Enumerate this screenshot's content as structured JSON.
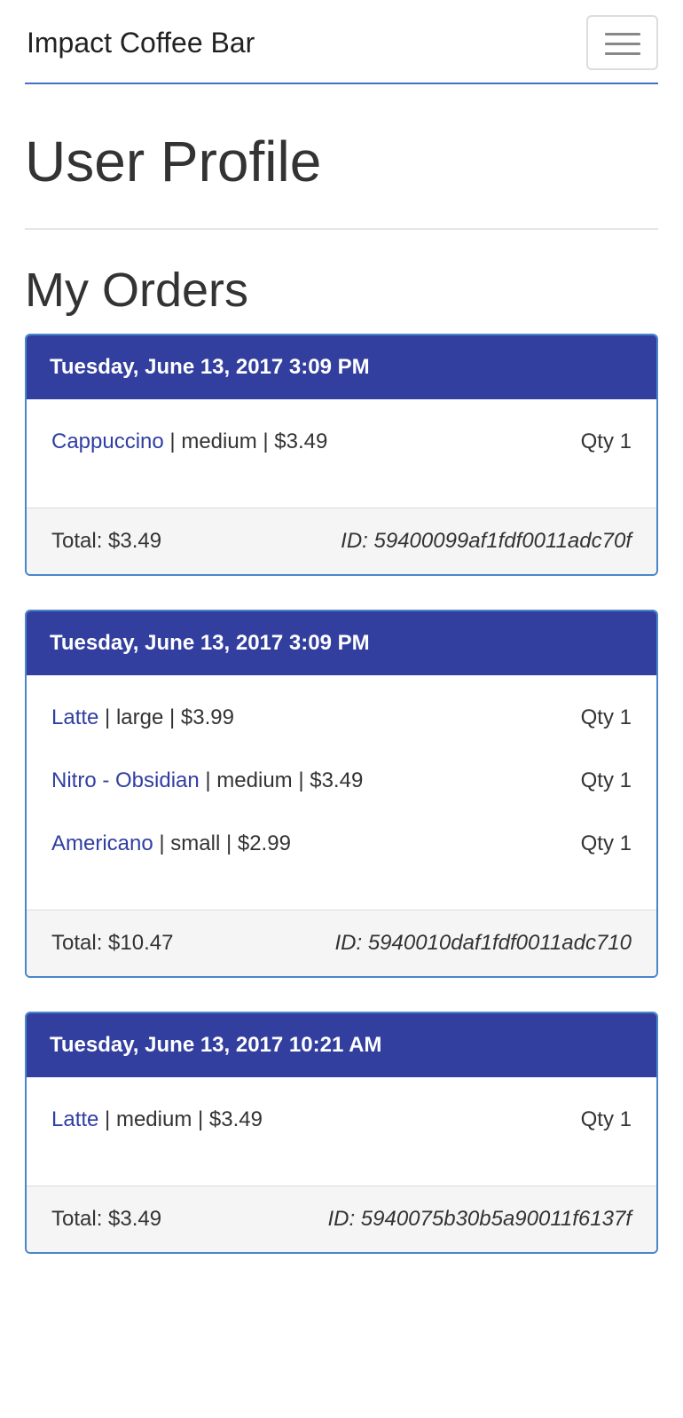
{
  "navbar": {
    "brand": "Impact Coffee Bar",
    "menu_icon": "hamburger-menu-icon"
  },
  "page_title": "User Profile",
  "section_title": "My Orders",
  "colors": {
    "order_header_bg": "#323f9f",
    "link": "#2f3ea3",
    "card_border": "#4a86c9",
    "footer_bg": "#f5f5f5"
  },
  "orders": [
    {
      "date": "Tuesday, June 13, 2017 3:09 PM",
      "items": [
        {
          "name": "Cappuccino",
          "detail": " | medium | $3.49",
          "qty": "Qty 1"
        }
      ],
      "total": "Total: $3.49",
      "id": "ID: 59400099af1fdf0011adc70f"
    },
    {
      "date": "Tuesday, June 13, 2017 3:09 PM",
      "items": [
        {
          "name": "Latte",
          "detail": " | large | $3.99",
          "qty": "Qty 1"
        },
        {
          "name": "Nitro - Obsidian",
          "detail": " | medium | $3.49",
          "qty": "Qty 1"
        },
        {
          "name": "Americano",
          "detail": " | small | $2.99",
          "qty": "Qty 1"
        }
      ],
      "total": "Total: $10.47",
      "id": "ID: 5940010daf1fdf0011adc710"
    },
    {
      "date": "Tuesday, June 13, 2017 10:21 AM",
      "items": [
        {
          "name": "Latte",
          "detail": " | medium | $3.49",
          "qty": "Qty 1"
        }
      ],
      "total": "Total: $3.49",
      "id": "ID: 5940075b30b5a90011f6137f"
    }
  ]
}
